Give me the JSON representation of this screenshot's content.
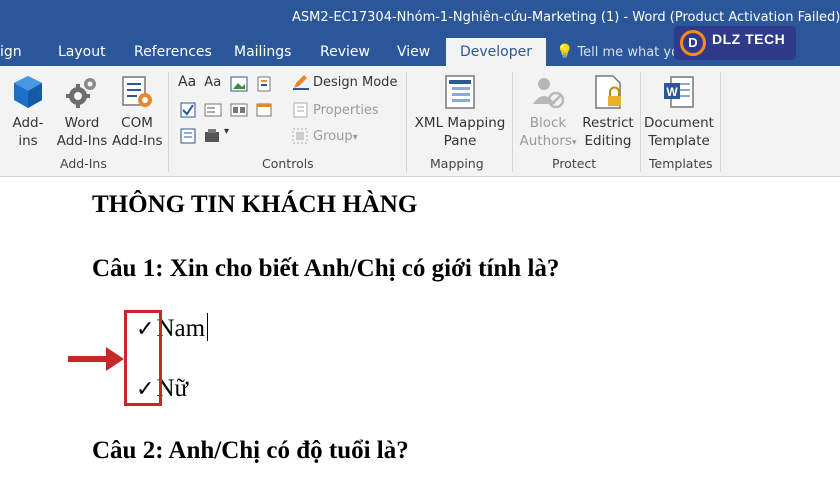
{
  "window": {
    "title": "ASM2-EC17304-Nhóm-1-Nghiên-cứu-Marketing (1) - Word (Product Activation Failed)"
  },
  "tabs": [
    {
      "label": "ign"
    },
    {
      "label": "Layout"
    },
    {
      "label": "References"
    },
    {
      "label": "Mailings"
    },
    {
      "label": "Review"
    },
    {
      "label": "View"
    },
    {
      "label": "Developer",
      "active": true
    }
  ],
  "tell_me": {
    "placeholder": "Tell me what you want to do"
  },
  "logo": {
    "text": "DLZ TECH",
    "mark": "D"
  },
  "ribbon": {
    "addins": {
      "group_label": "Add-Ins",
      "buttons": [
        {
          "line1": "Add-",
          "line2": "ins",
          "icon": "cube-icon"
        },
        {
          "line1": "Word",
          "line2": "Add-Ins",
          "icon": "gears-icon"
        },
        {
          "line1": "COM",
          "line2": "Add-Ins",
          "icon": "com-addins-icon"
        }
      ]
    },
    "controls": {
      "group_label": "Controls",
      "design_mode": "Design Mode",
      "properties": "Properties",
      "group": "Group",
      "aa1": "Aa",
      "aa2": "Aa"
    },
    "mapping": {
      "group_label": "Mapping",
      "button": {
        "line1": "XML Mapping",
        "line2": "Pane"
      }
    },
    "protect": {
      "group_label": "Protect",
      "block": {
        "line1": "Block",
        "line2": "Authors"
      },
      "restrict": {
        "line1": "Restrict",
        "line2": "Editing"
      }
    },
    "templates": {
      "group_label": "Templates",
      "button": {
        "line1": "Document",
        "line2": "Template"
      }
    }
  },
  "document": {
    "title": "THÔNG TIN KHÁCH HÀNG",
    "question1": "Câu 1: Xin cho biết Anh/Chị có giới tính là?",
    "options": [
      {
        "check": "✓",
        "label": "Nam"
      },
      {
        "check": "✓",
        "label": "Nữ"
      }
    ],
    "question2": "Câu 2: Anh/Chị có độ tuổi là?"
  },
  "colors": {
    "word_blue": "#2b579a",
    "highlight_red": "#c62828",
    "ribbon_bg": "#f3f3f3"
  }
}
